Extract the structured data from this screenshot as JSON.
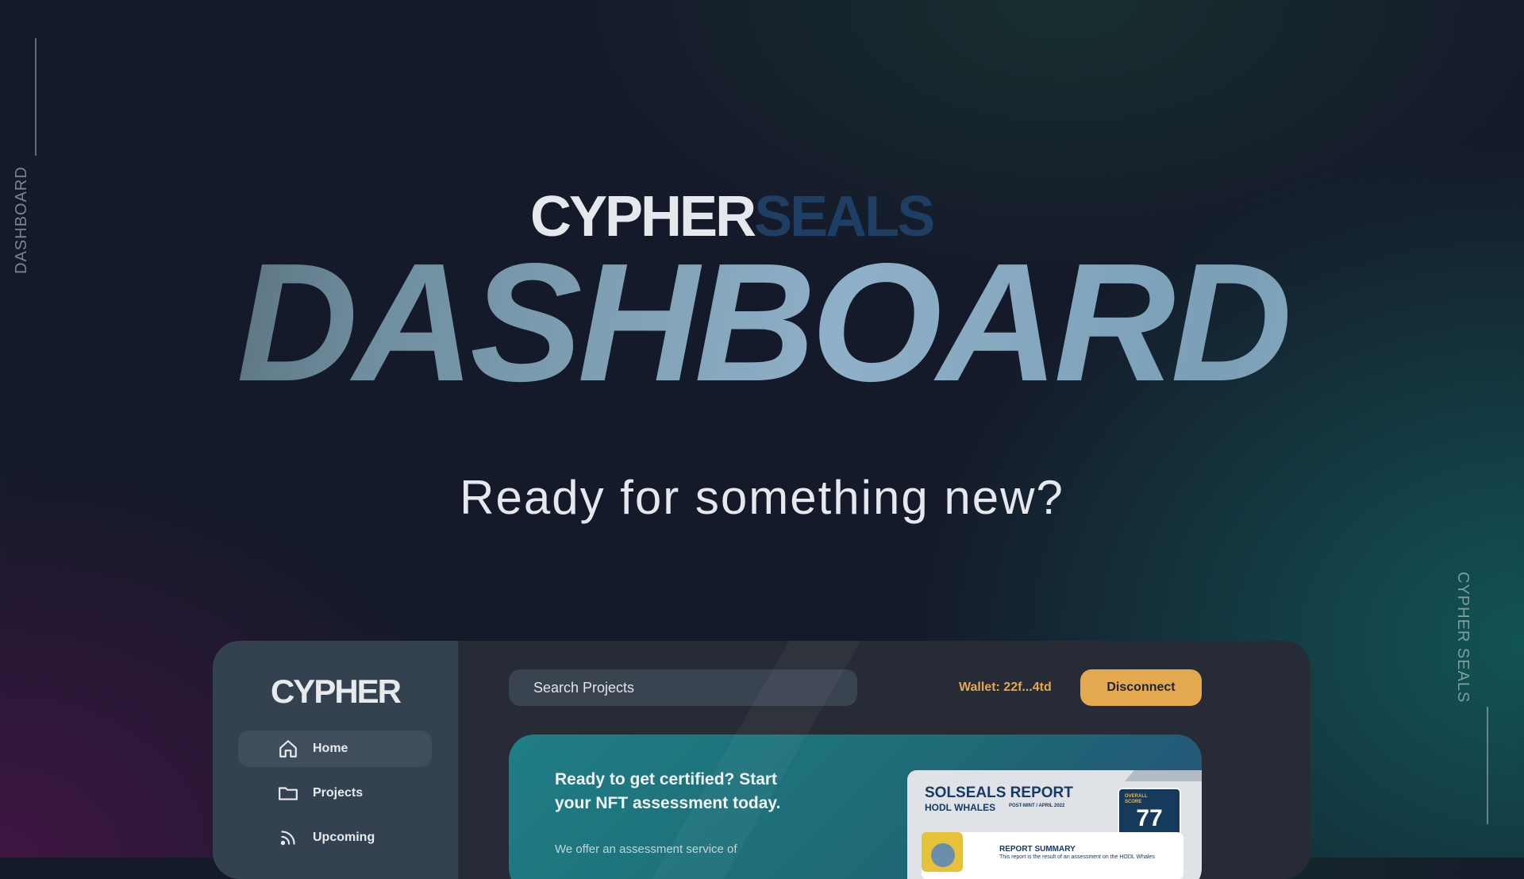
{
  "side_labels": {
    "left": "DASHBOARD",
    "right": "CYPHER SEALS"
  },
  "brand": {
    "part1": "CYPHER",
    "part2": "SEALS"
  },
  "hero": {
    "title": "DASHBOARD",
    "tagline": "Ready for something new?"
  },
  "app": {
    "logo": "CYPHER",
    "nav": [
      {
        "label": "Home",
        "icon": "home-icon",
        "active": true
      },
      {
        "label": "Projects",
        "icon": "folder-icon",
        "active": false
      },
      {
        "label": "Upcoming",
        "icon": "rss-icon",
        "active": false
      }
    ],
    "search": {
      "placeholder": "Search Projects"
    },
    "wallet": "Wallet: 22f...4td",
    "disconnect_label": "Disconnect",
    "banner": {
      "title": "Ready to get certified? Start your NFT assessment today.",
      "subtitle": "We offer an assessment service of"
    },
    "report": {
      "title": "SOLSEALS REPORT",
      "subtitle": "HODL WHALES",
      "meta": "POST-MINT / APRIL 2022",
      "score_label": "OVERALL SCORE",
      "score": "77",
      "summary_title": "REPORT SUMMARY",
      "summary_text": "This report is the result of an assessment on the HODL Whales"
    }
  },
  "colors": {
    "accent": "#e4a84e",
    "brand_dark": "#1e3f63",
    "panel": "#262b35",
    "sidebar": "#334150"
  }
}
